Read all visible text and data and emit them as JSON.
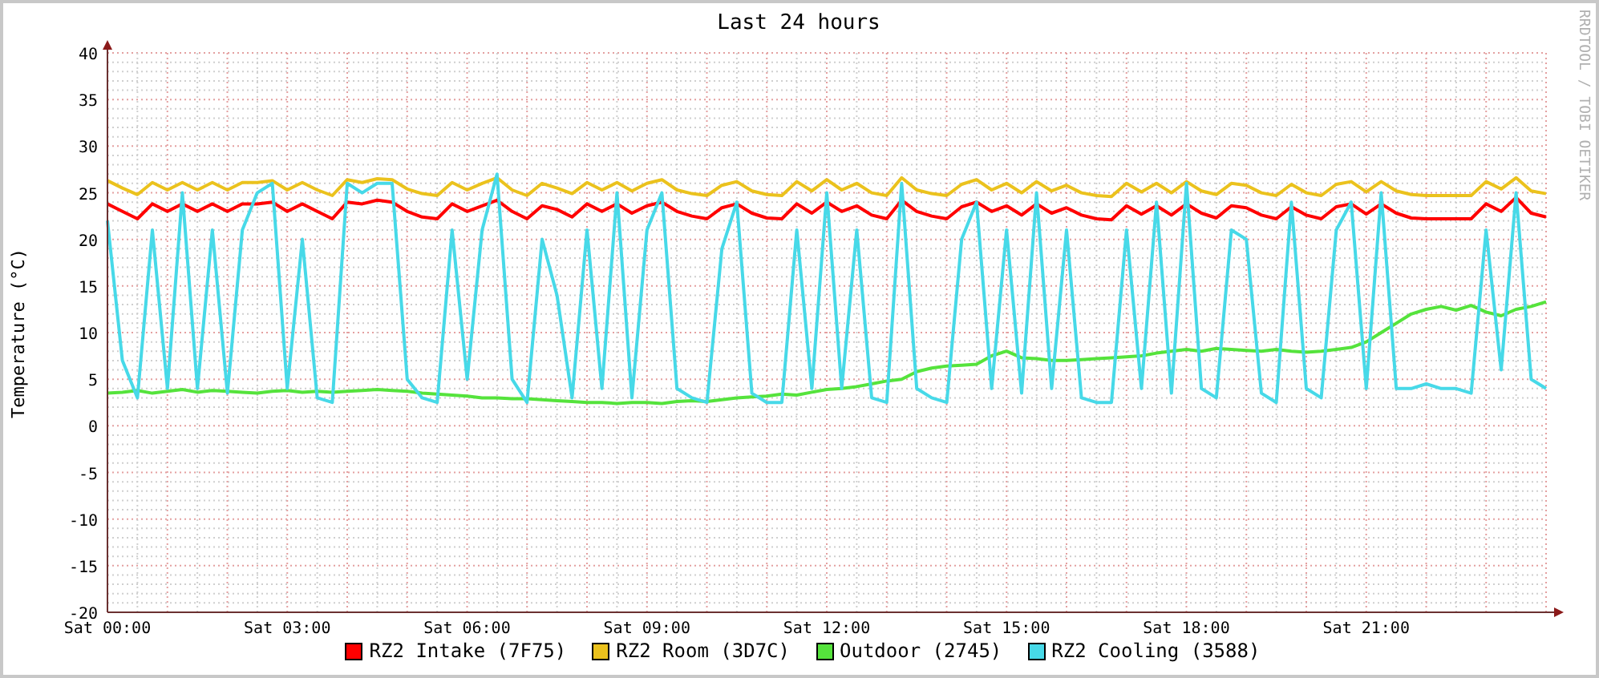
{
  "title": "Last 24 hours",
  "credit": "RRDTOOL / TOBI OETIKER",
  "chart_data": {
    "type": "line",
    "ylabel": "Temperature (°C)",
    "grid": true,
    "ylim": [
      -20,
      40
    ],
    "categories": [
      "Sat 00:00",
      null,
      null,
      null,
      null,
      null,
      null,
      null,
      null,
      null,
      null,
      null,
      "Sat 03:00",
      null,
      null,
      null,
      null,
      null,
      null,
      null,
      null,
      null,
      null,
      null,
      "Sat 06:00",
      null,
      null,
      null,
      null,
      null,
      null,
      null,
      null,
      null,
      null,
      null,
      "Sat 09:00",
      null,
      null,
      null,
      null,
      null,
      null,
      null,
      null,
      null,
      null,
      null,
      "Sat 12:00",
      null,
      null,
      null,
      null,
      null,
      null,
      null,
      null,
      null,
      null,
      null,
      "Sat 15:00",
      null,
      null,
      null,
      null,
      null,
      null,
      null,
      null,
      null,
      null,
      null,
      "Sat 18:00",
      null,
      null,
      null,
      null,
      null,
      null,
      null,
      null,
      null,
      null,
      null,
      "Sat 21:00",
      null,
      null,
      null,
      null,
      null,
      null,
      null,
      null,
      null,
      null,
      null,
      null
    ],
    "yticks": [
      -20,
      -15,
      -10,
      -5,
      0,
      5,
      10,
      15,
      20,
      25,
      30,
      35,
      40
    ],
    "series": [
      {
        "name": "RZ2 Intake (7F75)",
        "color": "#ff0000",
        "values": [
          23.8,
          23,
          22.2,
          23.8,
          23,
          23.8,
          23,
          23.8,
          23,
          23.8,
          23.8,
          24,
          23,
          23.8,
          23,
          22.2,
          24,
          23.8,
          24.2,
          24,
          23,
          22.4,
          22.2,
          23.8,
          23,
          23.6,
          24.2,
          23,
          22.2,
          23.6,
          23.2,
          22.4,
          23.8,
          23,
          23.8,
          22.8,
          23.6,
          24,
          23,
          22.5,
          22.2,
          23.4,
          23.8,
          22.8,
          22.3,
          22.2,
          23.8,
          22.8,
          24,
          23,
          23.6,
          22.6,
          22.2,
          24.2,
          23,
          22.5,
          22.2,
          23.5,
          24,
          23,
          23.6,
          22.6,
          23.8,
          22.8,
          23.4,
          22.6,
          22.2,
          22.1,
          23.6,
          22.7,
          23.6,
          22.6,
          23.8,
          22.8,
          22.3,
          23.6,
          23.4,
          22.6,
          22.2,
          23.5,
          22.6,
          22.2,
          23.5,
          23.8,
          22.7,
          23.8,
          22.8,
          22.3,
          22.2,
          22.2,
          22.2,
          22.2,
          23.8,
          23,
          24.5,
          22.8,
          22.4
        ]
      },
      {
        "name": "RZ2 Room (3D7C)",
        "color": "#ebc21d",
        "values": [
          26.3,
          25.5,
          24.8,
          26.1,
          25.3,
          26.1,
          25.3,
          26.1,
          25.3,
          26.1,
          26.1,
          26.3,
          25.3,
          26.1,
          25.3,
          24.7,
          26.4,
          26.1,
          26.5,
          26.4,
          25.4,
          24.9,
          24.7,
          26.1,
          25.3,
          26,
          26.6,
          25.3,
          24.7,
          26,
          25.5,
          24.9,
          26.1,
          25.3,
          26.1,
          25.2,
          26,
          26.4,
          25.3,
          24.9,
          24.7,
          25.8,
          26.2,
          25.2,
          24.8,
          24.7,
          26.2,
          25.2,
          26.4,
          25.3,
          26,
          25,
          24.7,
          26.6,
          25.3,
          24.9,
          24.7,
          25.9,
          26.4,
          25.3,
          26,
          25,
          26.2,
          25.2,
          25.8,
          25,
          24.7,
          24.6,
          26,
          25.1,
          26,
          25,
          26.2,
          25.2,
          24.8,
          26,
          25.8,
          25,
          24.7,
          25.9,
          25,
          24.7,
          25.9,
          26.2,
          25.1,
          26.2,
          25.2,
          24.8,
          24.7,
          24.7,
          24.7,
          24.7,
          26.2,
          25.4,
          26.6,
          25.2,
          24.9
        ]
      },
      {
        "name": "Outdoor (2745)",
        "color": "#55e33c",
        "values": [
          3.5,
          3.6,
          3.8,
          3.5,
          3.7,
          3.9,
          3.6,
          3.8,
          3.7,
          3.6,
          3.5,
          3.7,
          3.8,
          3.6,
          3.7,
          3.6,
          3.7,
          3.8,
          3.9,
          3.8,
          3.7,
          3.5,
          3.4,
          3.3,
          3.2,
          3,
          3,
          2.9,
          2.9,
          2.8,
          2.7,
          2.6,
          2.5,
          2.5,
          2.4,
          2.5,
          2.5,
          2.4,
          2.6,
          2.7,
          2.6,
          2.8,
          3,
          3.1,
          3.2,
          3.4,
          3.3,
          3.6,
          3.9,
          4,
          4.2,
          4.5,
          4.8,
          5,
          5.8,
          6.2,
          6.4,
          6.5,
          6.6,
          7.5,
          8,
          7.3,
          7.2,
          7,
          7,
          7.1,
          7.2,
          7.3,
          7.4,
          7.5,
          7.8,
          8,
          8.2,
          8,
          8.3,
          8.2,
          8.1,
          8,
          8.2,
          8,
          7.9,
          8,
          8.2,
          8.4,
          9,
          10,
          11,
          12,
          12.5,
          12.8,
          12.4,
          12.9,
          12.2,
          11.8,
          12.5,
          12.8,
          13.3
        ]
      },
      {
        "name": "RZ2 Cooling (3588)",
        "color": "#47d9e8",
        "values": [
          22,
          7,
          3,
          21,
          4,
          25,
          4,
          21,
          3.5,
          21,
          25,
          26,
          4,
          20,
          3,
          2.5,
          26,
          25,
          26,
          26,
          5,
          3,
          2.5,
          21,
          5,
          21,
          27,
          5,
          2.5,
          20,
          14,
          3,
          21,
          4,
          25,
          3,
          21,
          25,
          4,
          3,
          2.5,
          19,
          24,
          3.5,
          2.5,
          2.5,
          21,
          4,
          25,
          4,
          21,
          3,
          2.5,
          26,
          4,
          3,
          2.5,
          20,
          24,
          4,
          21,
          3.5,
          25,
          4,
          21,
          3,
          2.5,
          2.5,
          21,
          4,
          24,
          3.5,
          26,
          4,
          3,
          21,
          20,
          3.5,
          2.5,
          24,
          4,
          3,
          21,
          24,
          4,
          25,
          4,
          4,
          4.5,
          4,
          4,
          3.5,
          21,
          6,
          25,
          5,
          4
        ]
      }
    ]
  }
}
